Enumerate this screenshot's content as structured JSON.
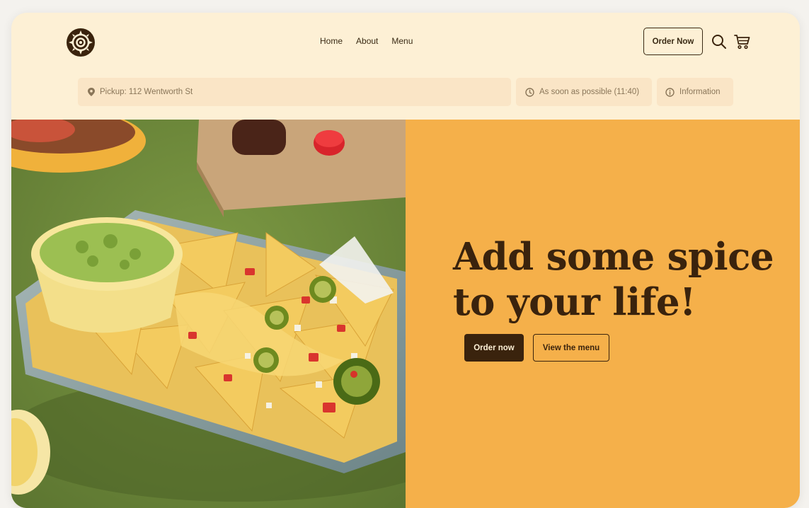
{
  "header": {
    "nav": [
      "Home",
      "About",
      "Menu"
    ],
    "order_button": "Order Now"
  },
  "info_bar": {
    "pickup": "Pickup: 112 Wentworth St",
    "time": "As soon as possible (11:40)",
    "information": "Information"
  },
  "hero": {
    "headline_line1": "Add some spice",
    "headline_line2": "to your life!",
    "primary_cta": "Order now",
    "secondary_cta": "View the menu",
    "image_subject": "nachos-with-guacamole"
  },
  "icons": {
    "logo": "sun-logo-icon",
    "search": "search-icon",
    "cart": "cart-icon",
    "location": "map-pin-icon",
    "clock": "clock-icon",
    "info": "info-icon"
  },
  "colors": {
    "background": "#fdf0d5",
    "pill": "#fae5c6",
    "dark": "#3a230d",
    "accent": "#f5b04a",
    "table_green": "#6f8a3a"
  }
}
